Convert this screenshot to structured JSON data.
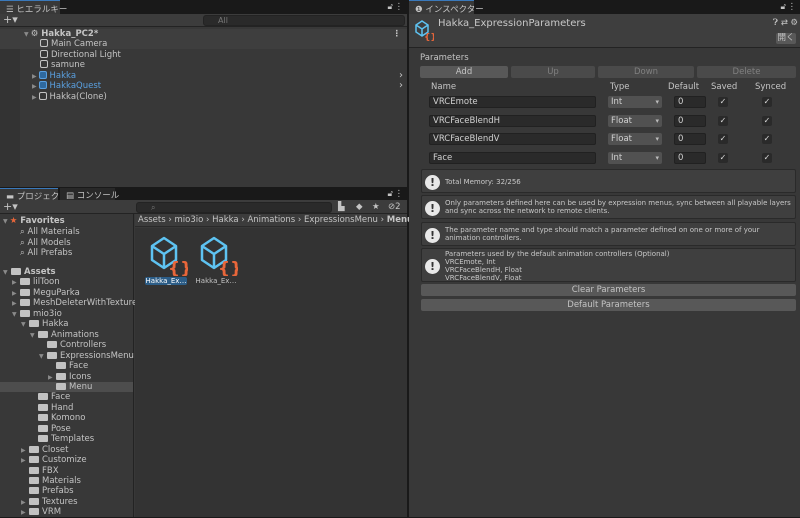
{
  "hierarchy": {
    "tab": "ヒエラルキー",
    "search_placeholder": "All",
    "scene": "Hakka_PC2*",
    "items": [
      {
        "label": "Main Camera",
        "prefab": false,
        "arrow": false
      },
      {
        "label": "Directional Light",
        "prefab": false,
        "arrow": false
      },
      {
        "label": "samune",
        "prefab": false,
        "arrow": false
      },
      {
        "label": "Hakka",
        "prefab": true,
        "arrow": true
      },
      {
        "label": "HakkaQuest",
        "prefab": true,
        "arrow": true
      },
      {
        "label": "Hakka(Clone)",
        "prefab": false,
        "arrow": true
      }
    ]
  },
  "project": {
    "tab": "プロジェクト",
    "console_tab": "コンソール",
    "hidden_count": "2",
    "favorites": {
      "label": "Favorites",
      "items": [
        "All Materials",
        "All Models",
        "All Prefabs"
      ]
    },
    "tree": [
      {
        "label": "Assets",
        "lvl": 0,
        "exp": true
      },
      {
        "label": "lilToon",
        "lvl": 1,
        "arrow": true
      },
      {
        "label": "MeguParka",
        "lvl": 1,
        "arrow": true
      },
      {
        "label": "MeshDeleterWithTexture",
        "lvl": 1,
        "arrow": true
      },
      {
        "label": "mio3io",
        "lvl": 1,
        "exp": true
      },
      {
        "label": "Hakka",
        "lvl": 2,
        "exp": true
      },
      {
        "label": "Animations",
        "lvl": 3,
        "exp": true
      },
      {
        "label": "Controllers",
        "lvl": 4
      },
      {
        "label": "ExpressionsMenu",
        "lvl": 4,
        "exp": true
      },
      {
        "label": "Face",
        "lvl": 5
      },
      {
        "label": "Icons",
        "lvl": 5,
        "arrow": true
      },
      {
        "label": "Menu",
        "lvl": 5,
        "selected": true
      },
      {
        "label": "Face",
        "lvl": 3
      },
      {
        "label": "Hand",
        "lvl": 3
      },
      {
        "label": "Komono",
        "lvl": 3
      },
      {
        "label": "Pose",
        "lvl": 3
      },
      {
        "label": "Templates",
        "lvl": 3
      },
      {
        "label": "Closet",
        "lvl": 2,
        "arrow": true
      },
      {
        "label": "Customize",
        "lvl": 2,
        "arrow": true
      },
      {
        "label": "FBX",
        "lvl": 2
      },
      {
        "label": "Materials",
        "lvl": 2
      },
      {
        "label": "Prefabs",
        "lvl": 2
      },
      {
        "label": "Textures",
        "lvl": 2,
        "arrow": true
      },
      {
        "label": "VRM",
        "lvl": 2,
        "arrow": true
      }
    ],
    "breadcrumb": [
      "Assets",
      "mio3io",
      "Hakka",
      "Animations",
      "ExpressionsMenu",
      "Menu"
    ],
    "assets": [
      "Hakka_Ex…",
      "Hakka_Ex…"
    ]
  },
  "inspector": {
    "tab": "インスペクター",
    "title": "Hakka_ExpressionParameters",
    "open_label": "開く",
    "section": "Parameters",
    "buttons": {
      "add": "Add",
      "up": "Up",
      "down": "Down",
      "delete": "Delete"
    },
    "columns": {
      "name": "Name",
      "type": "Type",
      "default": "Default",
      "saved": "Saved",
      "synced": "Synced"
    },
    "params": [
      {
        "name": "VRCEmote",
        "type": "Int",
        "default": "0",
        "saved": true,
        "synced": true
      },
      {
        "name": "VRCFaceBlendH",
        "type": "Float",
        "default": "0",
        "saved": true,
        "synced": true
      },
      {
        "name": "VRCFaceBlendV",
        "type": "Float",
        "default": "0",
        "saved": true,
        "synced": true
      },
      {
        "name": "Face",
        "type": "Int",
        "default": "0",
        "saved": true,
        "synced": true
      }
    ],
    "help": [
      "Total Memory: 32/256",
      "Only parameters defined here can be used by expression menus, sync between all playable layers and sync across the network to remote clients.",
      "The parameter name and type should match a parameter defined on one or more of your animation controllers.",
      "Parameters used by the default animation controllers (Optional)\nVRCEmote, Int\nVRCFaceBlendH, Float\nVRCFaceBlendV, Float"
    ],
    "clear": "Clear Parameters",
    "defaults": "Default Parameters"
  },
  "colors": {
    "accent": "#3a79bb",
    "prefab": "#5aa0e0",
    "brace": "#e8663a"
  }
}
